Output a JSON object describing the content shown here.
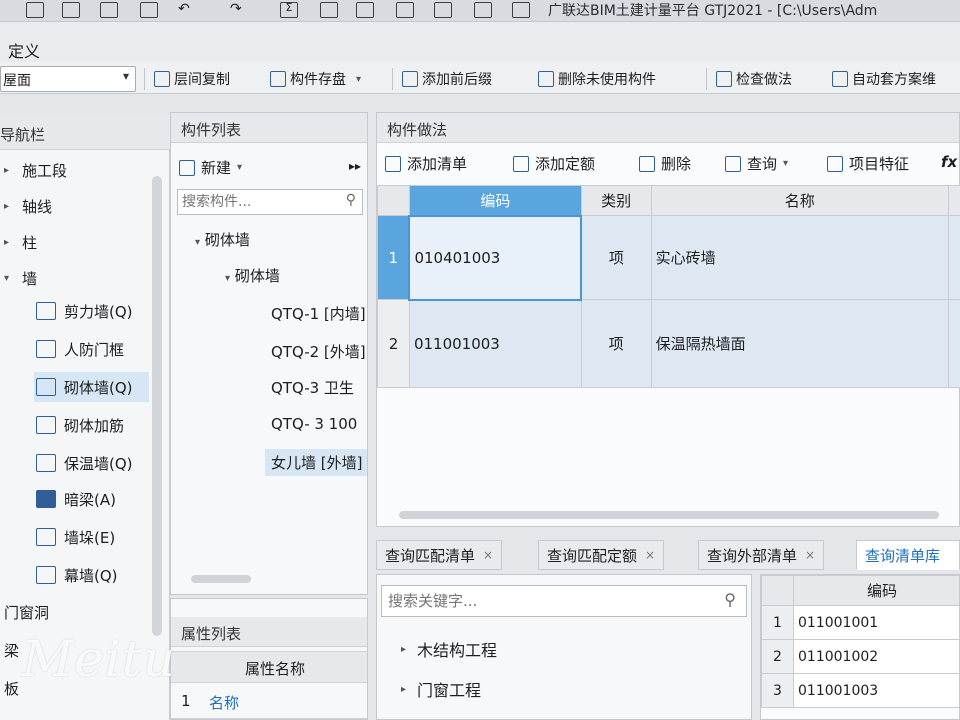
{
  "titlebar": {
    "title": "广联达BIM土建计量平台 GTJ2021 - [C:\\Users\\Adm"
  },
  "menu": {
    "item": "定义"
  },
  "toolbar": {
    "floor": "屋面",
    "buttons": [
      "层间复制",
      "构件存盘",
      "添加前后缀",
      "删除未使用构件",
      "检查做法",
      "自动套方案维"
    ]
  },
  "nav": {
    "title": "导航栏",
    "items": [
      "施工段",
      "轴线",
      "柱",
      "墙"
    ],
    "wall_children": [
      "剪力墙(Q)",
      "人防门框",
      "砌体墙(Q)",
      "砌体加筋",
      "保温墙(Q)",
      "暗梁(A)",
      "墙垛(E)",
      "幕墙(Q)"
    ],
    "bottom": [
      "门窗洞",
      "梁",
      "板"
    ]
  },
  "complist": {
    "title": "构件列表",
    "new_label": "新建",
    "search_placeholder": "搜索构件...",
    "tree": [
      "砌体墙",
      "砌体墙",
      "QTQ-1 [内墙]",
      "QTQ-2 [外墙]",
      "QTQ-3 卫生",
      "QTQ- 3 100",
      "女儿墙 [外墙]"
    ]
  },
  "props": {
    "title": "属性列表",
    "col_name": "属性名称",
    "rows": [
      {
        "num": "1",
        "name": "名称"
      }
    ]
  },
  "method": {
    "title": "构件做法",
    "buttons": [
      "添加清单",
      "添加定额",
      "删除",
      "查询",
      "项目特征",
      "fx"
    ],
    "columns": [
      "编码",
      "类别",
      "名称"
    ],
    "rows": [
      {
        "num": "1",
        "code": "010401003",
        "type": "项",
        "name": "实心砖墙"
      },
      {
        "num": "2",
        "code": "011001003",
        "type": "项",
        "name": "保温隔热墙面"
      }
    ]
  },
  "bottom_tabs": [
    "查询匹配清单",
    "查询匹配定额",
    "查询外部清单",
    "查询清单库"
  ],
  "library": {
    "search_placeholder": "搜索关键字...",
    "tree": [
      "木结构工程",
      "门窗工程"
    ]
  },
  "code_table": {
    "header": "编码",
    "rows": [
      {
        "num": "1",
        "code": "011001001"
      },
      {
        "num": "2",
        "code": "011001002"
      },
      {
        "num": "3",
        "code": "011001003"
      }
    ]
  },
  "watermark": "Meitu"
}
